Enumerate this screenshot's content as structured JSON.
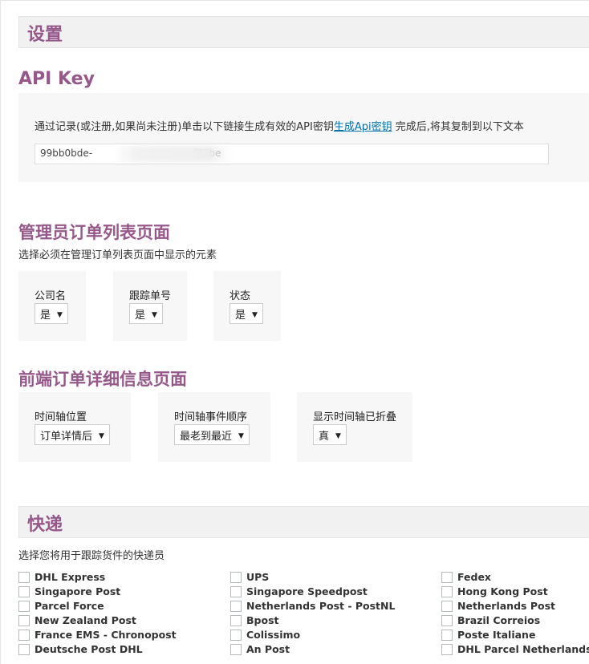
{
  "settings_title": "设置",
  "api_key": {
    "heading": "API Key",
    "text_before": "通过记录(或注册,如果尚未注册)单击以下链接生成有效的API密钥",
    "link": "生成Api密钥",
    "text_after": " 完成后,将其复制到以下文本",
    "value": "99bb0bde-                                 f73be"
  },
  "admin": {
    "heading": "管理员订单列表页面",
    "desc": "选择必须在管理订单列表页面中显示的元素",
    "fields": [
      {
        "label": "公司名",
        "value": "是"
      },
      {
        "label": "跟踪单号",
        "value": "是"
      },
      {
        "label": "状态",
        "value": "是"
      }
    ]
  },
  "frontend": {
    "heading": "前端订单详细信息页面",
    "fields": [
      {
        "label": "时间轴位置",
        "value": "订单详情后"
      },
      {
        "label": "时间轴事件顺序",
        "value": "最老到最近"
      },
      {
        "label": "显示时间轴已折叠",
        "value": "真"
      }
    ]
  },
  "couriers": {
    "heading": "快递",
    "desc": "选择您将用于跟踪货件的快递员",
    "col1": [
      "DHL Express",
      "Singapore Post",
      "Parcel Force",
      "New Zealand Post",
      "France EMS - Chronopost",
      "Deutsche Post DHL"
    ],
    "col2": [
      "UPS",
      "Singapore Speedpost",
      "Netherlands Post - PostNL",
      "Bpost",
      "Colissimo",
      "An Post"
    ],
    "col3": [
      "Fedex",
      "Hong Kong Post",
      "Netherlands Post",
      "Brazil Correios",
      "Poste Italiane",
      "DHL Parcel Netherlands"
    ]
  }
}
